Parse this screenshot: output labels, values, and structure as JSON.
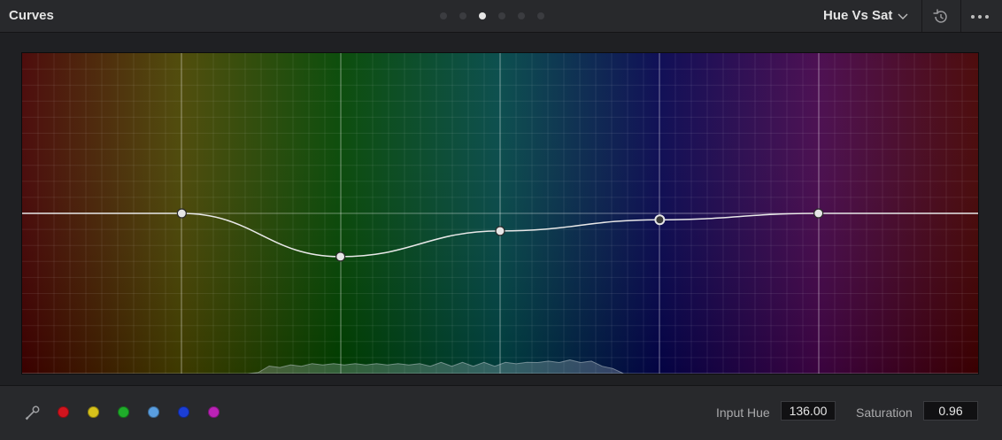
{
  "panel": {
    "title": "Curves",
    "mode": "Hue Vs Sat"
  },
  "pagination": {
    "count": 6,
    "active_index": 2
  },
  "graph": {
    "curve_type": "Hue Vs Sat",
    "control_points": [
      {
        "hue_position": 0.167,
        "saturation": 1.0
      },
      {
        "hue_position": 0.333,
        "saturation": 0.73
      },
      {
        "hue_position": 0.5,
        "saturation": 0.89
      },
      {
        "hue_position": 0.667,
        "saturation": 0.96,
        "selected": true
      },
      {
        "hue_position": 0.833,
        "saturation": 1.0
      }
    ],
    "histogram_levels": [
      0,
      0,
      0,
      0,
      0,
      0,
      0,
      0,
      0,
      0,
      0,
      0,
      0,
      0,
      0,
      0,
      0,
      0,
      0,
      0,
      0,
      0,
      0.2,
      0.5,
      0.6,
      0.6,
      0.7,
      0.7,
      0.8,
      0.7,
      0.8,
      0.7,
      0.8,
      0.7,
      0.8,
      0.7,
      0.8,
      0.7,
      0.7,
      0.8,
      0.7,
      0.8,
      0.7,
      0.8,
      0.7,
      0.8,
      0.9,
      0.8,
      1.0,
      0.9,
      1.0,
      1.0,
      1.0,
      0.9,
      0.7,
      0.3,
      0,
      0,
      0,
      0,
      0,
      0,
      0,
      0,
      0,
      0,
      0,
      0,
      0,
      0,
      0,
      0,
      0,
      0,
      0,
      0,
      0,
      0,
      0,
      0,
      0,
      0,
      0,
      0,
      0,
      0,
      0,
      0,
      0,
      0
    ]
  },
  "footer": {
    "swatches": [
      {
        "name": "red",
        "color": "#d2141e"
      },
      {
        "name": "yellow",
        "color": "#d7c21b"
      },
      {
        "name": "green",
        "color": "#1fac2a"
      },
      {
        "name": "cyan",
        "color": "#5a9ee0"
      },
      {
        "name": "blue",
        "color": "#1b3ed6"
      },
      {
        "name": "magenta",
        "color": "#bb22b6"
      }
    ],
    "input_hue_label": "Input Hue",
    "input_hue_value": "136.00",
    "saturation_label": "Saturation",
    "saturation_value": "0.96"
  }
}
